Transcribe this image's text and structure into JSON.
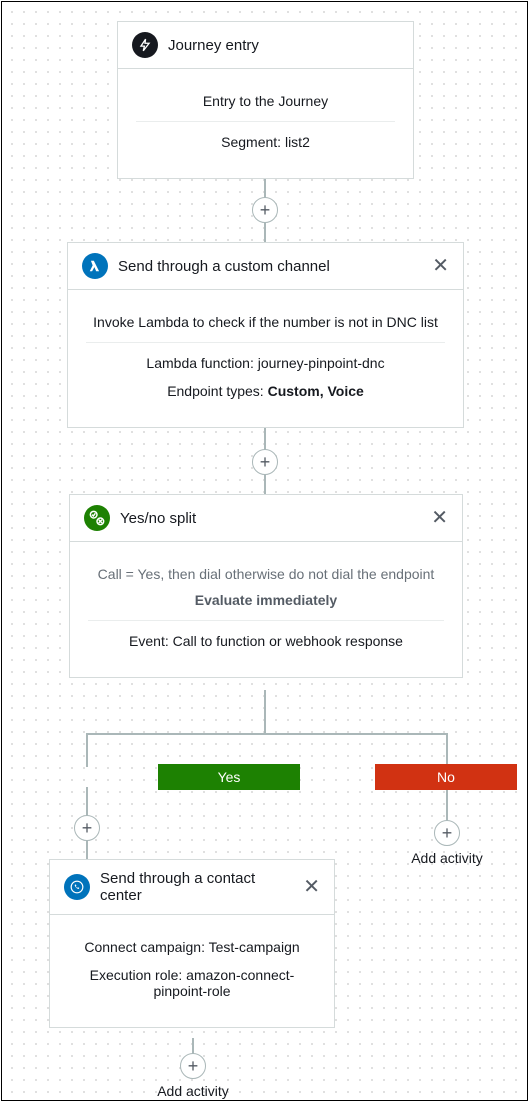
{
  "entry": {
    "title": "Journey entry",
    "entry_text": "Entry to the Journey",
    "segment_text": "Segment: list2"
  },
  "custom_channel": {
    "title": "Send through a custom channel",
    "desc": "Invoke Lambda to check if the number is not in DNC list",
    "lambda_text": "Lambda function: journey-pinpoint-dnc",
    "endpoint_label": "Endpoint types: ",
    "endpoint_value": "Custom, Voice"
  },
  "split": {
    "title": "Yes/no split",
    "condition": "Call = Yes, then dial otherwise do not dial the endpoint",
    "evaluate": "Evaluate immediately",
    "event_label": "Event:  Call to function or webhook response",
    "yes_label": "Yes",
    "no_label": "No"
  },
  "contact_center": {
    "title": "Send through a contact center",
    "campaign": "Connect campaign: Test-campaign",
    "role": "Execution role: amazon-connect-pinpoint-role"
  },
  "add_activity_label": "Add activity"
}
